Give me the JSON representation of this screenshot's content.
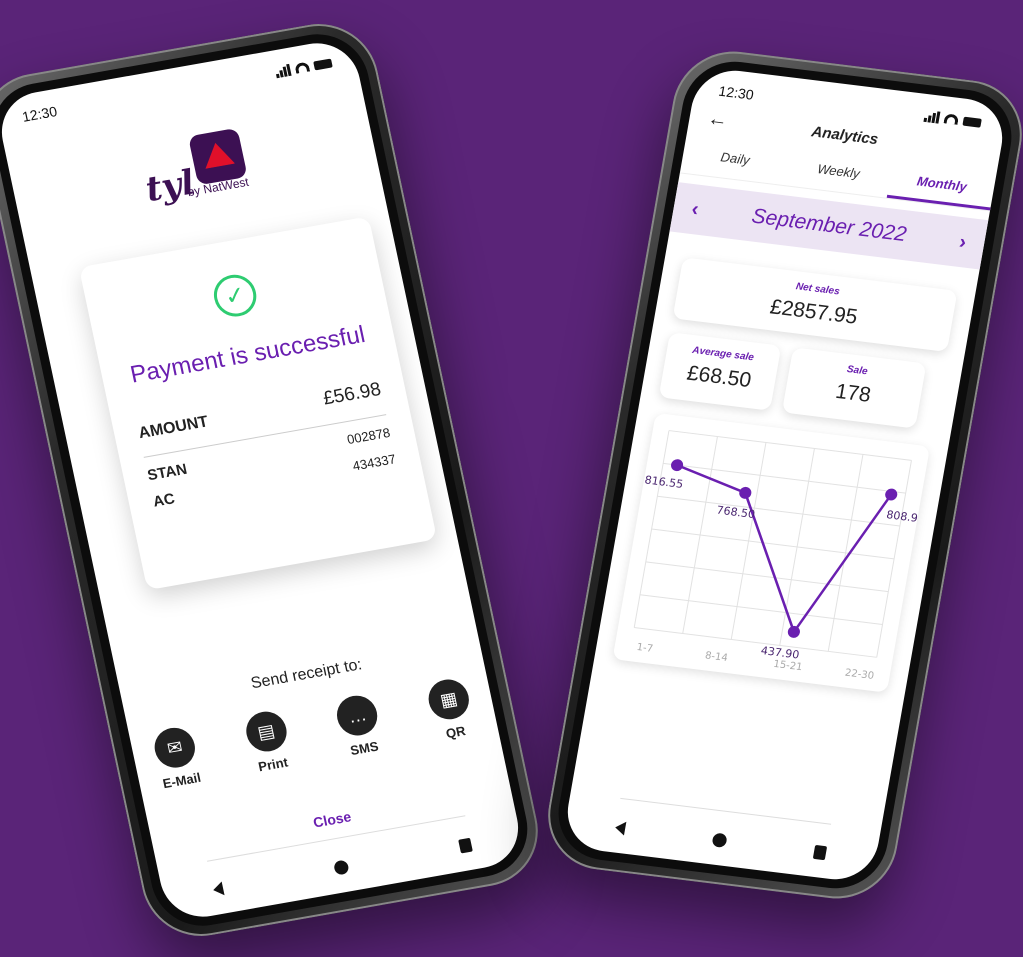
{
  "left_phone": {
    "status": {
      "time": "12:30"
    },
    "logo": {
      "brand": "tyl",
      "sub": "by NatWest"
    },
    "payment": {
      "title": "Payment is successful",
      "amount_label": "AMOUNT",
      "amount_value": "£56.98",
      "rows": [
        {
          "label": "STAN",
          "value": "002878"
        },
        {
          "label": "AC",
          "value": "434337"
        }
      ]
    },
    "receipt": {
      "label": "Send receipt to:",
      "options": [
        {
          "label": "E-Mail",
          "icon": "mail-icon"
        },
        {
          "label": "Print",
          "icon": "printer-icon"
        },
        {
          "label": "SMS",
          "icon": "message-icon"
        },
        {
          "label": "QR",
          "icon": "qr-icon"
        }
      ]
    },
    "close_label": "Close"
  },
  "right_phone": {
    "status": {
      "time": "12:30"
    },
    "title": "Analytics",
    "tabs": [
      {
        "label": "Daily",
        "active": false
      },
      {
        "label": "Weekly",
        "active": false
      },
      {
        "label": "Monthly",
        "active": true
      }
    ],
    "month": "September 2022",
    "net_sales": {
      "label": "Net sales",
      "value": "£2857.95"
    },
    "average_sale": {
      "label": "Average sale",
      "value": "£68.50"
    },
    "sale": {
      "label": "Sale",
      "value": "178"
    },
    "accent": "#6a1fb0"
  },
  "chart_data": {
    "type": "line",
    "categories": [
      "1-7",
      "8-14",
      "15-21",
      "22-30"
    ],
    "values": [
      816.55,
      768.5,
      437.9,
      808.9
    ],
    "data_labels": [
      "816.55",
      "768.50",
      "437.90",
      "808.90"
    ],
    "grid": true
  }
}
